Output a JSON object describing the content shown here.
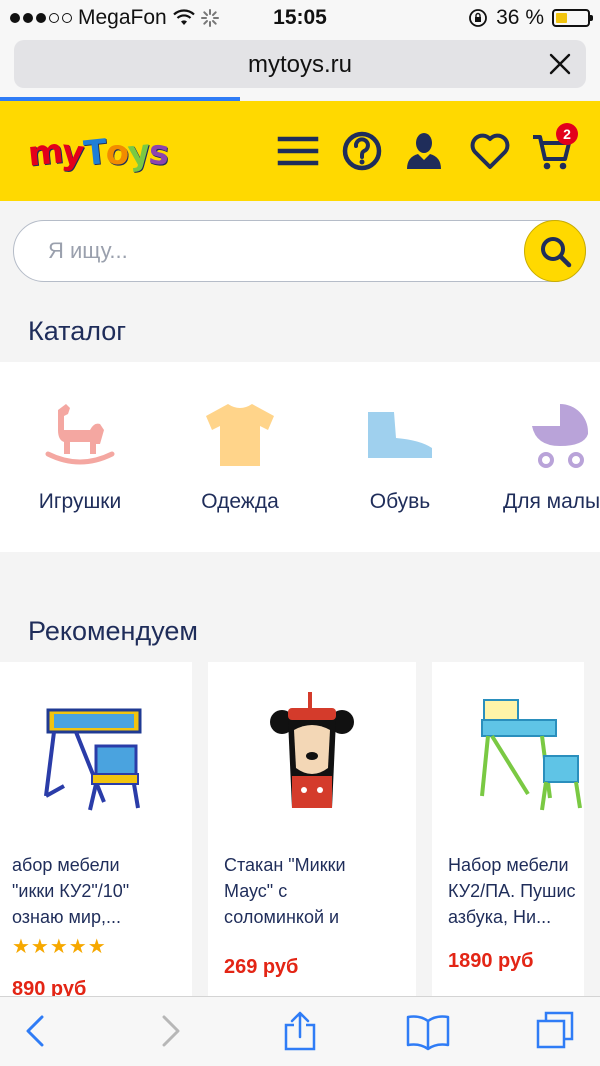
{
  "status_bar": {
    "carrier": "MegaFon",
    "time": "15:05",
    "battery": "36 %",
    "battery_level": 0.36
  },
  "browser": {
    "url": "mytoys.ru",
    "load_progress": 0.4
  },
  "header": {
    "logo": "myToys",
    "icons": [
      "menu-icon",
      "help-icon",
      "account-icon",
      "wishlist-icon",
      "cart-icon"
    ],
    "cart_count": "2",
    "colors": {
      "background": "#ffd900",
      "icons": "#1f2d5a",
      "badge": "#e3001b"
    }
  },
  "search": {
    "placeholder": "Я ищу..."
  },
  "catalog": {
    "title": "Каталог",
    "items": [
      {
        "label": "Игрушки",
        "icon": "rocking-horse-icon",
        "color": "#f4a7a1"
      },
      {
        "label": "Одежда",
        "icon": "tshirt-icon",
        "color": "#ffd48a"
      },
      {
        "label": "Обувь",
        "icon": "shoe-icon",
        "color": "#9fd0ee"
      },
      {
        "label": "Для малыш",
        "icon": "stroller-icon",
        "color": "#b9a3d9"
      }
    ]
  },
  "recommended": {
    "title": "Рекомендуем",
    "products": [
      {
        "name": "абор мебели\n\"икки КУ2\"/10\"\nознаю мир,...",
        "rating_stars": "★★★★★",
        "price": "890 руб"
      },
      {
        "name": "Стакан \"Микки\nМаус\" с\nсоломинкой и",
        "price": "269 руб"
      },
      {
        "name": "Набор мебели\nКУ2/ПА. Пушис\nазбука, Ни...",
        "price": "1890 руб"
      }
    ]
  },
  "toolbar": {
    "icons": [
      "back-icon",
      "forward-icon",
      "share-icon",
      "bookmarks-icon",
      "tabs-icon"
    ]
  }
}
